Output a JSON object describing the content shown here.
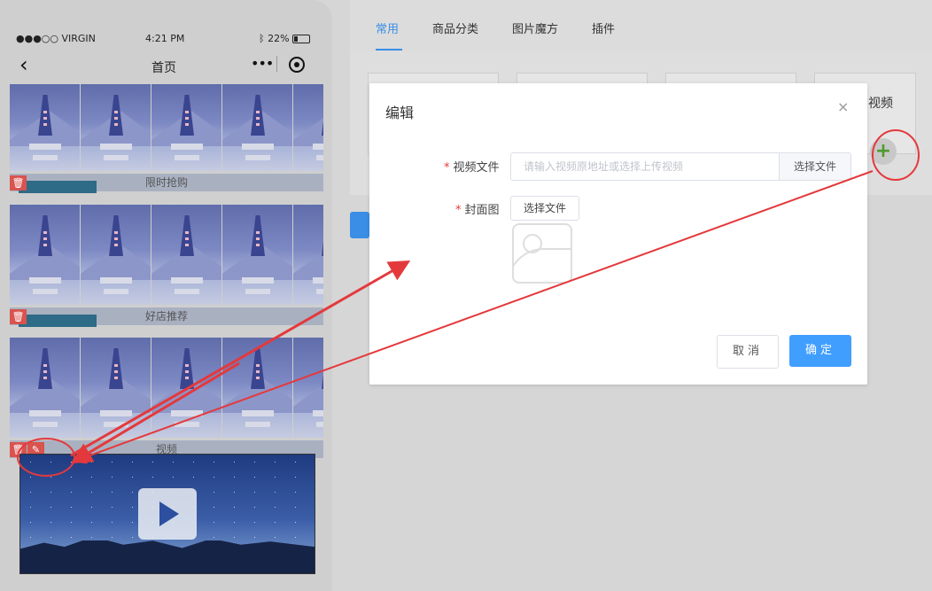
{
  "phone": {
    "status": {
      "carrier": "●●●○○ VIRGIN",
      "wifi_icon": "wifi-icon",
      "time": "4:21 PM",
      "battery": "22%",
      "bluetooth_icon": "bluetooth-icon"
    },
    "nav": {
      "back_icon": "chevron-left-icon",
      "title": "首页",
      "more": "•••",
      "target_icon": "target-icon"
    },
    "blocks": [
      {
        "label": "限时抢购"
      },
      {
        "label": "好店推荐"
      },
      {
        "label": "视频"
      }
    ],
    "trash_icon": "trash-icon",
    "edit_icon": "edit-icon",
    "play_icon": "play-icon"
  },
  "editor": {
    "tabs": [
      "常用",
      "商品分类",
      "图片魔方",
      "插件"
    ],
    "active_tab": "常用",
    "video_component_label": "视频",
    "add_icon": "+"
  },
  "modal": {
    "title": "编辑",
    "close": "×",
    "video_file_label": "视频文件",
    "video_file_placeholder": "请输入视频原地址或选择上传视频",
    "video_file_value": "",
    "choose_file": "选择文件",
    "cover_label": "封面图",
    "cover_choose": "选择文件",
    "cancel": "取消",
    "confirm": "确定",
    "required_mark": "*"
  },
  "colors": {
    "accent": "#409eff",
    "annotation": "#e4393c",
    "delete": "#d9534f"
  }
}
